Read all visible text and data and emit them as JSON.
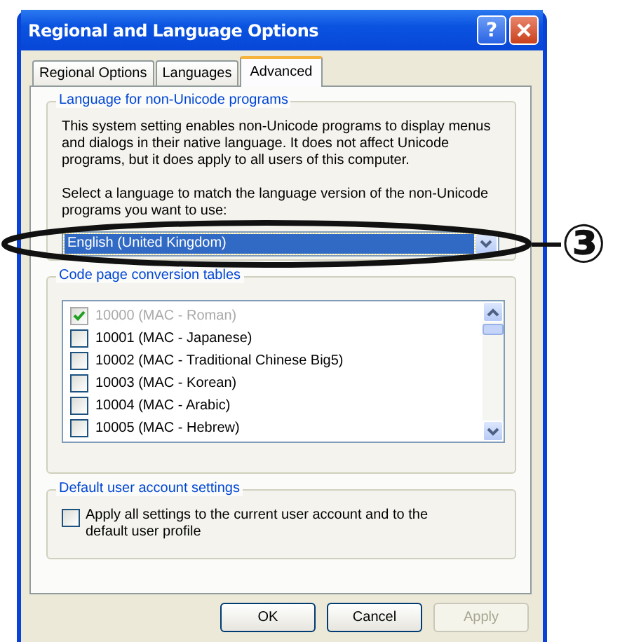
{
  "window": {
    "title": "Regional and Language Options"
  },
  "title_buttons": [
    {
      "kind": "help",
      "label": "?"
    },
    {
      "kind": "close"
    }
  ],
  "tabs": [
    {
      "label": "Regional Options",
      "selected": false
    },
    {
      "label": "Languages",
      "selected": false
    },
    {
      "label": "Advanced",
      "selected": true
    }
  ],
  "non_unicode_group": {
    "title": "Language for non-Unicode programs",
    "description": "This system setting enables non-Unicode programs to display menus and dialogs in their native language. It does not affect Unicode programs, but it does apply to all users of this computer.",
    "prompt": "Select a language to match the language version of the non-Unicode programs you want to use:",
    "dropdown": {
      "value": "English (United Kingdom)"
    }
  },
  "code_page_group": {
    "title": "Code page conversion tables",
    "items": [
      {
        "label": "10000 (MAC - Roman)",
        "checked": true,
        "disabled": true
      },
      {
        "label": "10001 (MAC - Japanese)",
        "checked": false,
        "disabled": false
      },
      {
        "label": "10002 (MAC - Traditional Chinese Big5)",
        "checked": false,
        "disabled": false
      },
      {
        "label": "10003 (MAC - Korean)",
        "checked": false,
        "disabled": false
      },
      {
        "label": "10004 (MAC - Arabic)",
        "checked": false,
        "disabled": false
      },
      {
        "label": "10005 (MAC - Hebrew)",
        "checked": false,
        "disabled": false
      }
    ]
  },
  "default_user_group": {
    "title": "Default user account settings",
    "checkbox": {
      "label": "Apply all settings to the current user account and to the default user profile",
      "checked": false
    }
  },
  "buttons": [
    {
      "label": "OK",
      "disabled": false
    },
    {
      "label": "Cancel",
      "disabled": false
    },
    {
      "label": "Apply",
      "disabled": true
    }
  ],
  "annotation": {
    "label": "③"
  }
}
